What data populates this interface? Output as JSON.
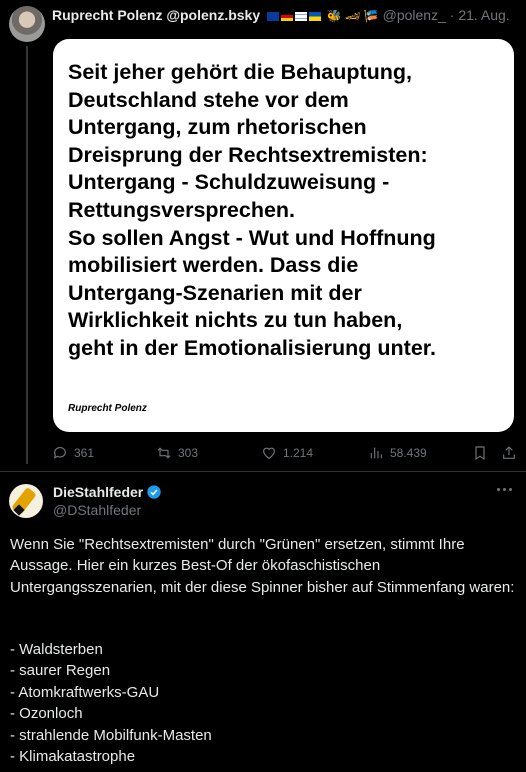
{
  "post1": {
    "author_name": "Ruprecht Polenz @polenz.bsky",
    "name_glyphs": "🐝 🏎 🎏",
    "handle": "@polenz_",
    "date": "· 21. Aug.",
    "quote_image": {
      "text": "Seit jeher gehört die Behauptung,\nDeutschland stehe vor dem\nUntergang, zum rhetorischen\nDreisprung der Rechtsextremisten:\nUntergang - Schuldzuweisung -\nRettungsversprechen.\nSo sollen Angst - Wut und Hoffnung\nmobilisiert werden. Dass die\nUntergang-Szenarien mit der\nWirklichkeit nichts zu tun haben,\ngeht in der Emotionalisierung unter.",
      "author": "Ruprecht Polenz"
    },
    "actions": {
      "replies": "361",
      "reposts": "303",
      "likes": "1.214",
      "views": "58.439"
    }
  },
  "post2": {
    "author_name": "DieStahlfeder",
    "handle": "@DStahlfeder",
    "text": "Wenn Sie \"Rechtsextremisten\" durch \"Grünen\" ersetzen, stimmt Ihre Aussage. Hier ein kurzes Best-Of der ökofaschistischen Untergangsszenarien, mit der diese Spinner bisher auf Stimmenfang waren:",
    "list": [
      "- Waldsterben",
      "- saurer Regen",
      "- Atomkraftwerks-GAU",
      "- Ozonloch",
      "- strahlende Mobilfunk-Masten",
      "- Klimakatastrophe"
    ]
  },
  "colors": {
    "background": "#000000",
    "text": "#e7e9ea",
    "muted": "#71767b",
    "verified": "#1d9bf0"
  }
}
